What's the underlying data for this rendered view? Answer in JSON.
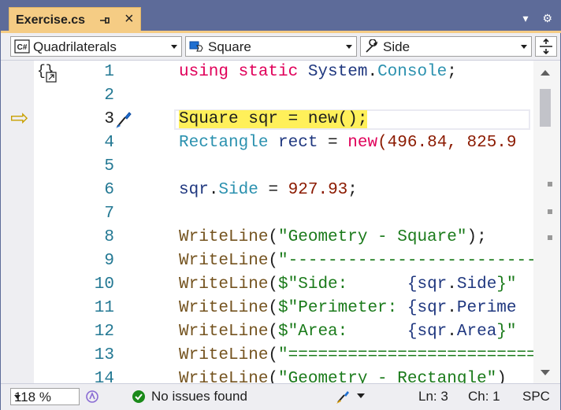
{
  "tab": {
    "title": "Exercise.cs",
    "pin_icon": "pin-icon",
    "close_glyph": "×"
  },
  "toolbar": {
    "dropdown_icon": "▾",
    "settings_icon": "⚙"
  },
  "nav": {
    "project": {
      "label": "Quadrilaterals",
      "badge": "C#"
    },
    "class": {
      "label": "Square"
    },
    "member": {
      "label": "Side"
    }
  },
  "editor": {
    "lines": [
      {
        "n": "1"
      },
      {
        "n": "2"
      },
      {
        "n": "3"
      },
      {
        "n": "4"
      },
      {
        "n": "5"
      },
      {
        "n": "6"
      },
      {
        "n": "7"
      },
      {
        "n": "8"
      },
      {
        "n": "9"
      },
      {
        "n": "10"
      },
      {
        "n": "11"
      },
      {
        "n": "12"
      },
      {
        "n": "13"
      },
      {
        "n": "14"
      }
    ],
    "code": {
      "l1_a": "using static ",
      "l1_b": "System",
      "l1_c": ".",
      "l1_d": "Console",
      "l1_e": ";",
      "l3": "Square sqr = new();",
      "l4_a": "Rectangle ",
      "l4_b": "rect",
      "l4_c": " = ",
      "l4_d": "new",
      "l4_e": "(496.84, 825.9",
      "l6_a": "sqr",
      "l6_b": ".",
      "l6_c": "Side",
      "l6_d": " = ",
      "l6_e": "927.93",
      "l6_f": ";",
      "l8_a": "WriteLine",
      "l8_b": "(",
      "l8_c": "\"Geometry - Square\"",
      "l8_d": ");",
      "l9_a": "WriteLine",
      "l9_b": "(",
      "l9_c": "\"---------------------------",
      "l10_a": "WriteLine",
      "l10_b": "(",
      "l10_c": "$\"Side:      ",
      "l10_d": "{",
      "l10_e": "sqr",
      "l10_f": ".",
      "l10_g": "Side",
      "l10_h": "}\"",
      "l11_a": "WriteLine",
      "l11_b": "(",
      "l11_c": "$\"Perimeter: ",
      "l11_d": "{",
      "l11_e": "sqr",
      "l11_f": ".",
      "l11_g": "Perime",
      "l12_a": "WriteLine",
      "l12_b": "(",
      "l12_c": "$\"Area:      ",
      "l12_d": "{",
      "l12_e": "sqr",
      "l12_f": ".",
      "l12_g": "Area",
      "l12_h": "}\"",
      "l13_a": "WriteLine",
      "l13_b": "(",
      "l13_c": "\"===========================",
      "l14_a": "WriteLine",
      "l14_b": "(",
      "l14_c": "\"Geometry - Rectangle\"",
      "l14_d": ")"
    },
    "glyphs": {
      "collapse": "{}",
      "execution_arrow": "⇨"
    }
  },
  "status": {
    "zoom": "118 %",
    "issues": "No issues found",
    "ln": "Ln: 3",
    "ch": "Ch: 1",
    "spc": "SPC"
  },
  "colors": {
    "accent": "#5d6b99",
    "tab": "#f5cc84",
    "highlight": "#fff05a",
    "ok": "#1a8a1a"
  }
}
